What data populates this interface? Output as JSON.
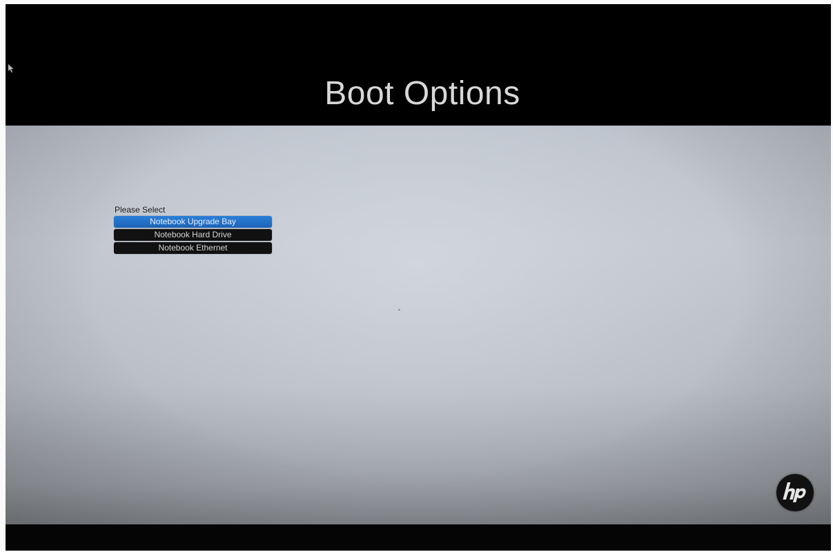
{
  "header": {
    "title": "Boot Options"
  },
  "menu": {
    "prompt": "Please Select",
    "selected_index": 0,
    "options": [
      {
        "label": "Notebook Upgrade Bay"
      },
      {
        "label": "Notebook Hard Drive"
      },
      {
        "label": "Notebook Ethernet"
      }
    ]
  },
  "logo": {
    "brand": "hp",
    "icon": "hp-logo-icon"
  },
  "cursor": {
    "icon": "mouse-pointer-icon"
  },
  "colors": {
    "selected_option": "#1d63b8",
    "option_background": "#111111",
    "panel": "#c3c8d0",
    "header": "#000000"
  }
}
